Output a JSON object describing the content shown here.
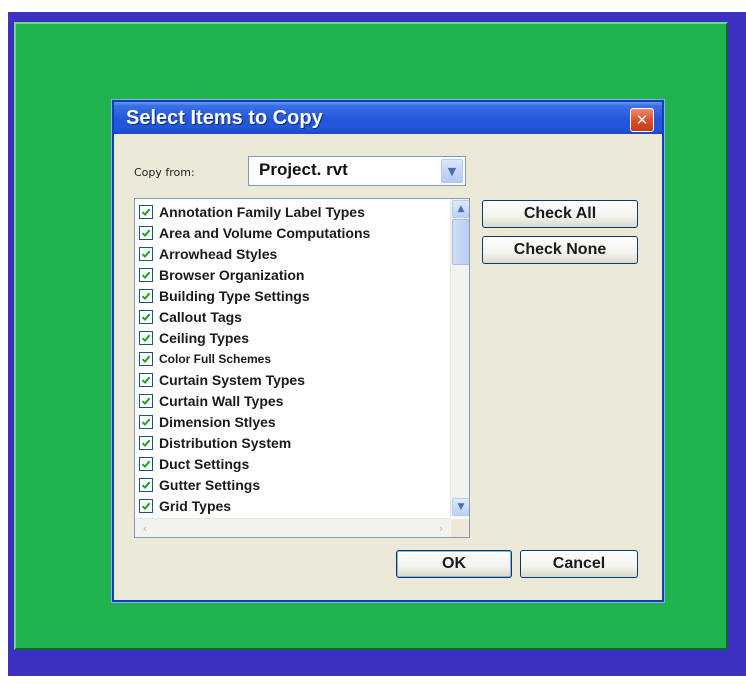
{
  "dialog": {
    "title": "Select Items to Copy",
    "close_glyph": "✕",
    "copy_from_label": "Copy from:",
    "copy_from_value": "Project. rvt",
    "items": [
      {
        "label": "Annotation Family Label Types",
        "checked": true
      },
      {
        "label": "Area and Volume Computations",
        "checked": true
      },
      {
        "label": "Arrowhead Styles",
        "checked": true
      },
      {
        "label": "Browser Organization",
        "checked": true
      },
      {
        "label": "Building Type Settings",
        "checked": true
      },
      {
        "label": "Callout Tags",
        "checked": true
      },
      {
        "label": "Ceiling Types",
        "checked": true
      },
      {
        "label": "Color Full Schemes",
        "checked": true
      },
      {
        "label": "Curtain System Types",
        "checked": true
      },
      {
        "label": "Curtain Wall Types",
        "checked": true
      },
      {
        "label": "Dimension Stlyes",
        "checked": true
      },
      {
        "label": "Distribution System",
        "checked": true
      },
      {
        "label": "Duct Settings",
        "checked": true
      },
      {
        "label": "Gutter Settings",
        "checked": true
      },
      {
        "label": "Grid Types",
        "checked": true
      }
    ],
    "check_all_label": "Check All",
    "check_none_label": "Check None",
    "ok_label": "OK",
    "cancel_label": "Cancel"
  },
  "colors": {
    "outer_frame": "#3b30c0",
    "green_frame": "#1fb24f",
    "title_bar": "#2456d8",
    "dialog_face": "#ece9d8",
    "checkmark": "#21a121"
  },
  "icons": {
    "close": "close-icon",
    "combo_arrow": "chevron-down-icon",
    "scroll_up": "scroll-up-icon",
    "scroll_down": "scroll-down-icon",
    "scroll_left": "scroll-left-icon",
    "scroll_right": "scroll-right-icon",
    "checkbox": "checkbox-checked-icon"
  }
}
